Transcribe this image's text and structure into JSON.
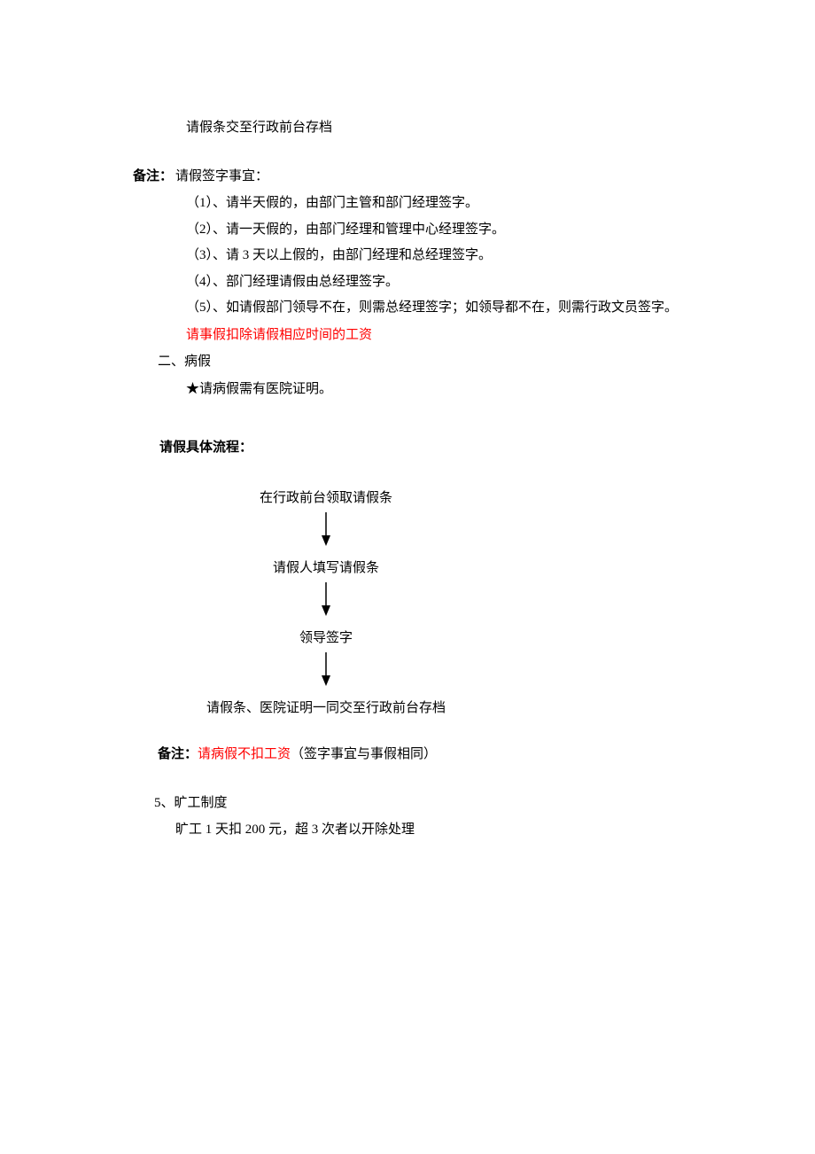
{
  "line1": "请假条交至行政前台存档",
  "note1": {
    "label": "备注：",
    "title": "请假签字事宜：",
    "items": [
      "（1）、请半天假的，由部门主管和部门经理签字。",
      "（2）、请一天假的，由部门经理和管理中心经理签字。",
      "（3）、请 3 天以上假的，由部门经理和总经理签字。",
      "（4）、部门经理请假由总经理签字。",
      "（5）、如请假部门领导不在，则需总经理签字；如领导都不在，则需行政文员签字。"
    ]
  },
  "red_note": "请事假扣除请假相应时间的工资",
  "sec2": {
    "heading": "二、病假",
    "star": "★请病假需有医院证明。"
  },
  "flow_title": "请假具体流程：",
  "flow": {
    "step1": "在行政前台领取请假条",
    "step2": "请假人填写请假条",
    "step3": "领导签字",
    "step4": "请假条、医院证明一同交至行政前台存档"
  },
  "note2": {
    "label": "备注：",
    "red": "请病假不扣工资",
    "rest": "（签字事宜与事假相同）"
  },
  "sec5": {
    "heading": "5、旷工制度",
    "body": "旷工 1 天扣 200 元，超 3 次者以开除处理"
  }
}
